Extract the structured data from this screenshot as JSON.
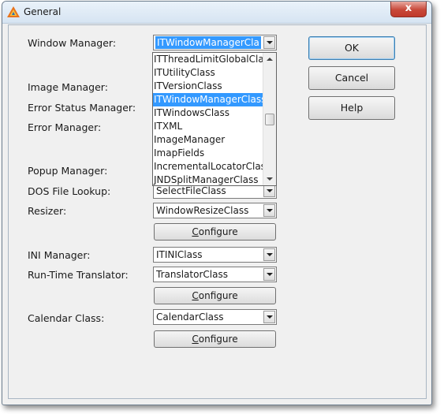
{
  "window": {
    "title": "General",
    "close_glyph": "x"
  },
  "fields": {
    "window_manager": {
      "label": "Window Manager:",
      "value": "ITWindowManagerCla"
    },
    "image_manager": {
      "label": "Image Manager:"
    },
    "error_status_manager": {
      "label": "Error Status Manager:"
    },
    "error_manager": {
      "label": "Error Manager:"
    },
    "popup_manager": {
      "label": "Popup Manager:"
    },
    "dos_file_lookup": {
      "label": "DOS File Lookup:",
      "value": "SelectFileClass"
    },
    "resizer": {
      "label": "Resizer:",
      "value": "WindowResizeClass"
    },
    "ini_manager": {
      "label": "INI Manager:",
      "value": "ITINIClass"
    },
    "runtime_translator": {
      "label": "Run-Time Translator:",
      "value": "TranslatorClass"
    },
    "calendar_class": {
      "label": "Calendar Class:",
      "value": "CalendarClass"
    }
  },
  "configure_label_parts": [
    "C",
    "onfigure"
  ],
  "buttons": {
    "ok": "OK",
    "cancel": "Cancel",
    "help": "Help"
  },
  "dropdown": {
    "items": [
      "ITThreadLimitGlobalClas",
      "ITUtilityClass",
      "ITVersionClass",
      "ITWindowManagerClass",
      "ITWindowsClass",
      "ITXML",
      "ImageManager",
      "ImapFields",
      "IncrementalLocatorClass",
      "JNDSplitManagerClass"
    ],
    "selected_index": 3
  },
  "icons": {
    "app": "app-triangle-icon",
    "close": "close-icon",
    "dropdown": "chevron-down-icon"
  },
  "colors": {
    "selection": "#3399ff",
    "close_button": "#c8493a",
    "window_bg": "#f0f0f0"
  }
}
